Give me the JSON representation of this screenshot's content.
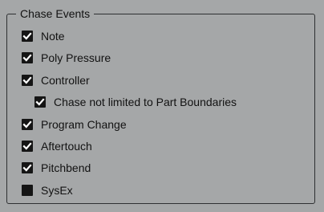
{
  "group": {
    "title": "Chase Events"
  },
  "options": {
    "note": {
      "label": "Note",
      "checked": true
    },
    "poly_pressure": {
      "label": "Poly Pressure",
      "checked": true
    },
    "controller": {
      "label": "Controller",
      "checked": true
    },
    "chase_not_limited": {
      "label": "Chase not limited to Part Boundaries",
      "checked": true
    },
    "program_change": {
      "label": "Program Change",
      "checked": true
    },
    "aftertouch": {
      "label": "Aftertouch",
      "checked": true
    },
    "pitchbend": {
      "label": "Pitchbend",
      "checked": true
    },
    "sysex": {
      "label": "SysEx",
      "checked": false
    }
  },
  "colors": {
    "background": "#a5a7a8",
    "checkbox_fill": "#151515",
    "checkmark": "#ffffff",
    "frame_border": "#2e3032",
    "text": "#121212"
  },
  "icons": {
    "checked": "checkmark-icon"
  }
}
